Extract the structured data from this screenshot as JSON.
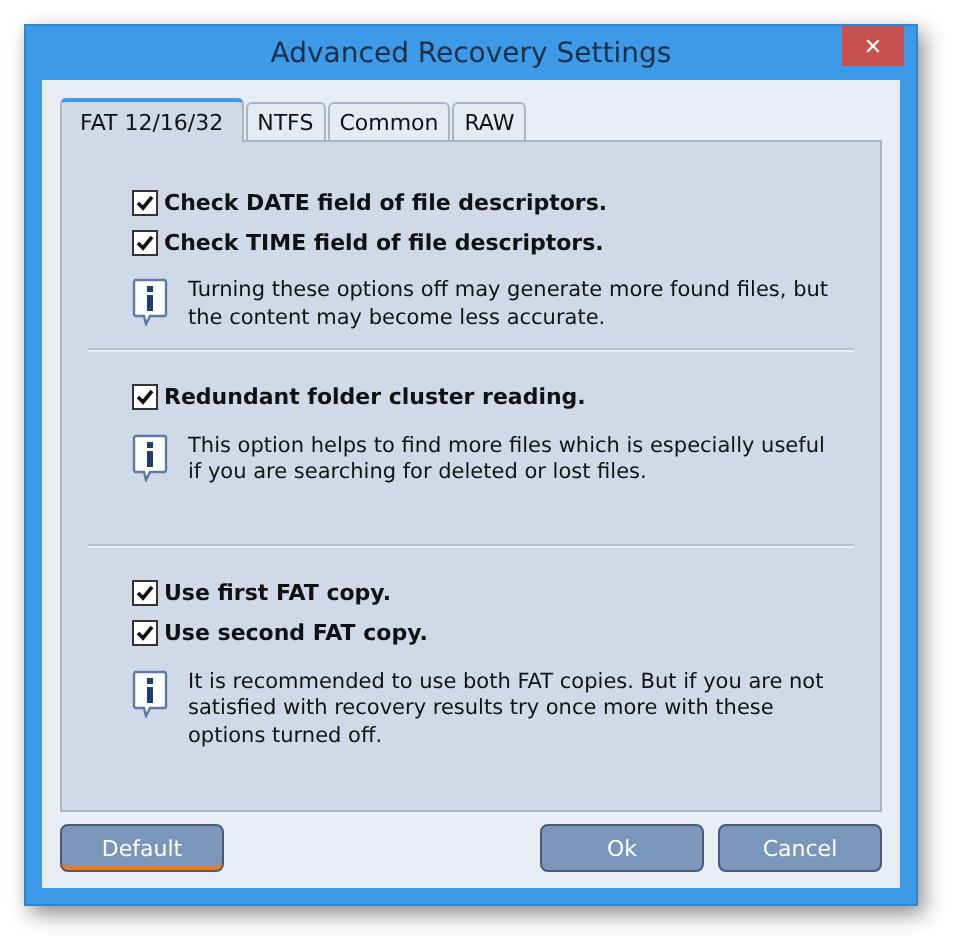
{
  "window": {
    "title": "Advanced Recovery Settings",
    "close": "✕"
  },
  "tabs": [
    {
      "label": "FAT 12/16/32",
      "selected": true
    },
    {
      "label": "NTFS",
      "selected": false
    },
    {
      "label": "Common",
      "selected": false
    },
    {
      "label": "RAW",
      "selected": false
    }
  ],
  "sections": [
    {
      "options": [
        {
          "label": "Check DATE field of file descriptors.",
          "checked": true
        },
        {
          "label": "Check TIME field of file descriptors.",
          "checked": true
        }
      ],
      "info": "Turning these options off may generate more found files, but the content may become less accurate."
    },
    {
      "options": [
        {
          "label": "Redundant folder cluster reading.",
          "checked": true
        }
      ],
      "info": "This option helps to find more files which is especially useful if you are searching for deleted or lost files."
    },
    {
      "options": [
        {
          "label": "Use first FAT copy.",
          "checked": true
        },
        {
          "label": "Use second FAT copy.",
          "checked": true
        }
      ],
      "info": "It is recommended to use both FAT copies. But if you are not satisfied with recovery results try once more with these options turned off."
    }
  ],
  "buttons": [
    {
      "label": "Default",
      "focused": true,
      "kind": "left"
    },
    {
      "label": "Ok",
      "focused": false,
      "kind": "right"
    },
    {
      "label": "Cancel",
      "focused": false,
      "kind": "right"
    }
  ]
}
